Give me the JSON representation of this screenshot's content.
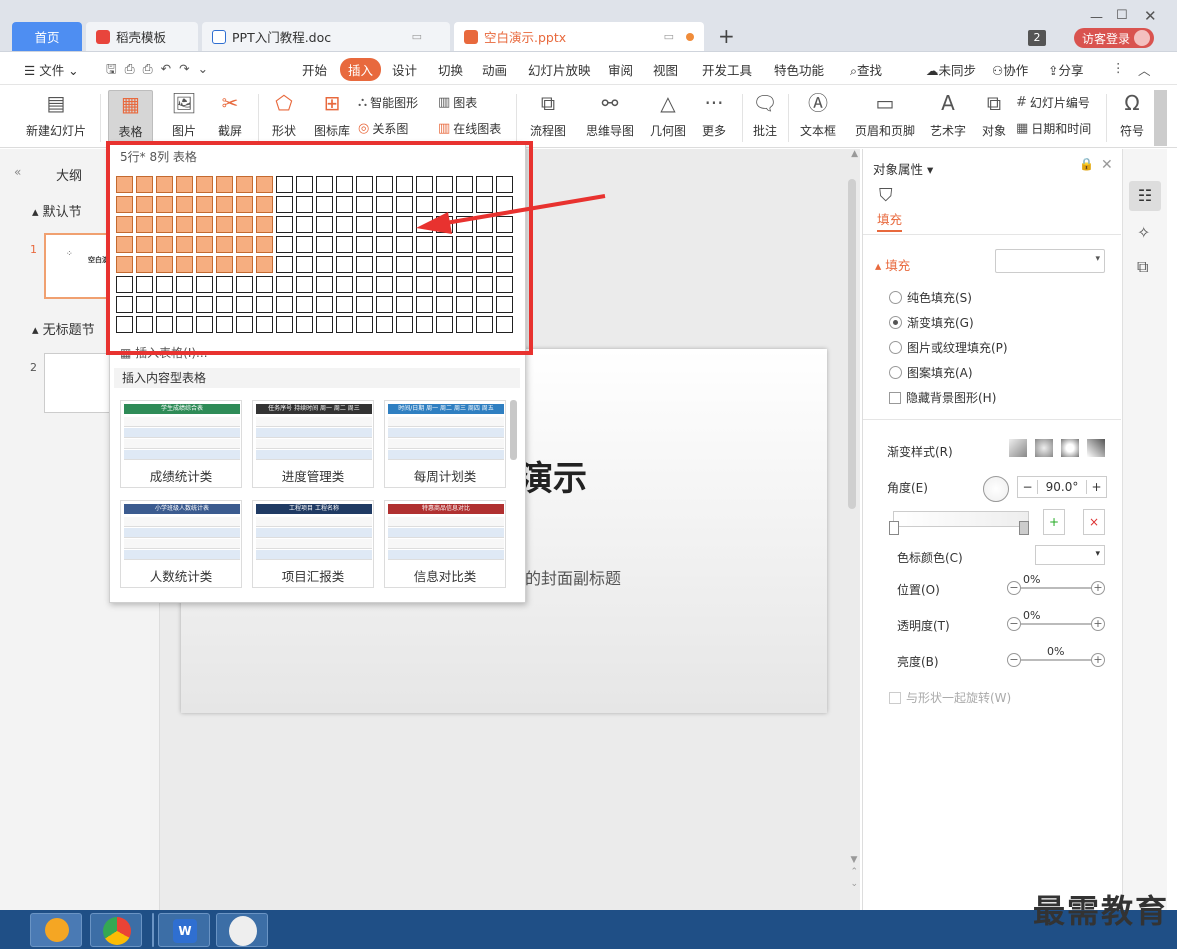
{
  "tabs": {
    "home": "首页",
    "docer": "稻壳模板",
    "doc": "PPT入门教程.doc",
    "ppt": "空白演示.pptx",
    "add": "+"
  },
  "topright": {
    "badge": "2",
    "login": "访客登录"
  },
  "menu": {
    "file": "文件",
    "items": [
      "开始",
      "插入",
      "设计",
      "切换",
      "动画",
      "幻灯片放映",
      "审阅",
      "视图",
      "开发工具",
      "特色功能"
    ],
    "search": "查找",
    "sync": "未同步",
    "collab": "协作",
    "share": "分享"
  },
  "ribbon": {
    "new_slide": "新建幻灯片",
    "table": "表格",
    "image": "图片",
    "screenshot": "截屏",
    "shape": "形状",
    "icon_lib": "图标库",
    "smart_shape": "智能图形",
    "chart": "图表",
    "relation": "关系图",
    "online_chart": "在线图表",
    "flowchart": "流程图",
    "mindmap": "思维导图",
    "geometry": "几何图",
    "more": "更多",
    "comment": "批注",
    "textbox": "文本框",
    "header_footer": "页眉和页脚",
    "wordart": "艺术字",
    "object": "对象",
    "slide_number": "幻灯片编号",
    "datetime": "日期和时间",
    "symbol": "符号"
  },
  "left_pane": {
    "outline": "大纲",
    "section_default": "默认节",
    "slide1_num": "1",
    "slide1_title": "空白演",
    "section_untitled": "无标题节",
    "slide2_num": "2"
  },
  "slide": {
    "title_visible": "演示",
    "subtitle_visible": "的封面副标题"
  },
  "dropdown": {
    "grid_label": "5行* 8列 表格",
    "grid_rows": 8,
    "grid_cols": 20,
    "selected_rows": 5,
    "selected_cols": 8,
    "insert_table": "插入表格(I)...",
    "content_tables_label": "插入内容型表格",
    "templates": [
      {
        "label": "成绩统计类",
        "header": "学生成绩综合表",
        "color": "#2e8b57"
      },
      {
        "label": "进度管理类",
        "header": "任务序号  持续时间  周一  周二  周三",
        "color": "#333333"
      },
      {
        "label": "每周计划类",
        "header": "时间/日期  周一  周二  周三  周四  周五",
        "color": "#2f7fc1"
      },
      {
        "label": "人数统计类",
        "header": "小学班级人数统计表",
        "color": "#3b5b8f"
      },
      {
        "label": "项目汇报类",
        "header": "工程项目   工程名称",
        "color": "#1f3a63"
      },
      {
        "label": "信息对比类",
        "header": "特惠商品信息对比",
        "color": "#b03030"
      }
    ]
  },
  "right_pane": {
    "title": "对象属性",
    "tab_fill": "填充",
    "section_fill": "填充",
    "options": [
      "纯色填充(S)",
      "渐变填充(G)",
      "图片或纹理填充(P)",
      "图案填充(A)"
    ],
    "selected_option": 1,
    "hide_bg": "隐藏背景图形(H)",
    "gradient_style": "渐变样式(R)",
    "angle_label": "角度(E)",
    "angle_value": "90.0°",
    "stop_color": "色标颜色(C)",
    "position": "位置(O)",
    "position_val": "0%",
    "transparency": "透明度(T)",
    "transparency_val": "0%",
    "brightness": "亮度(B)",
    "brightness_val": "0%",
    "rotate_with_shape": "与形状一起旋转(W)"
  },
  "watermark": "最需教育",
  "colors": {
    "accent": "#e8693d",
    "tab_blue": "#4e8ef2",
    "highlight_red": "#e8322f",
    "cell_on": "#f6ae80"
  }
}
